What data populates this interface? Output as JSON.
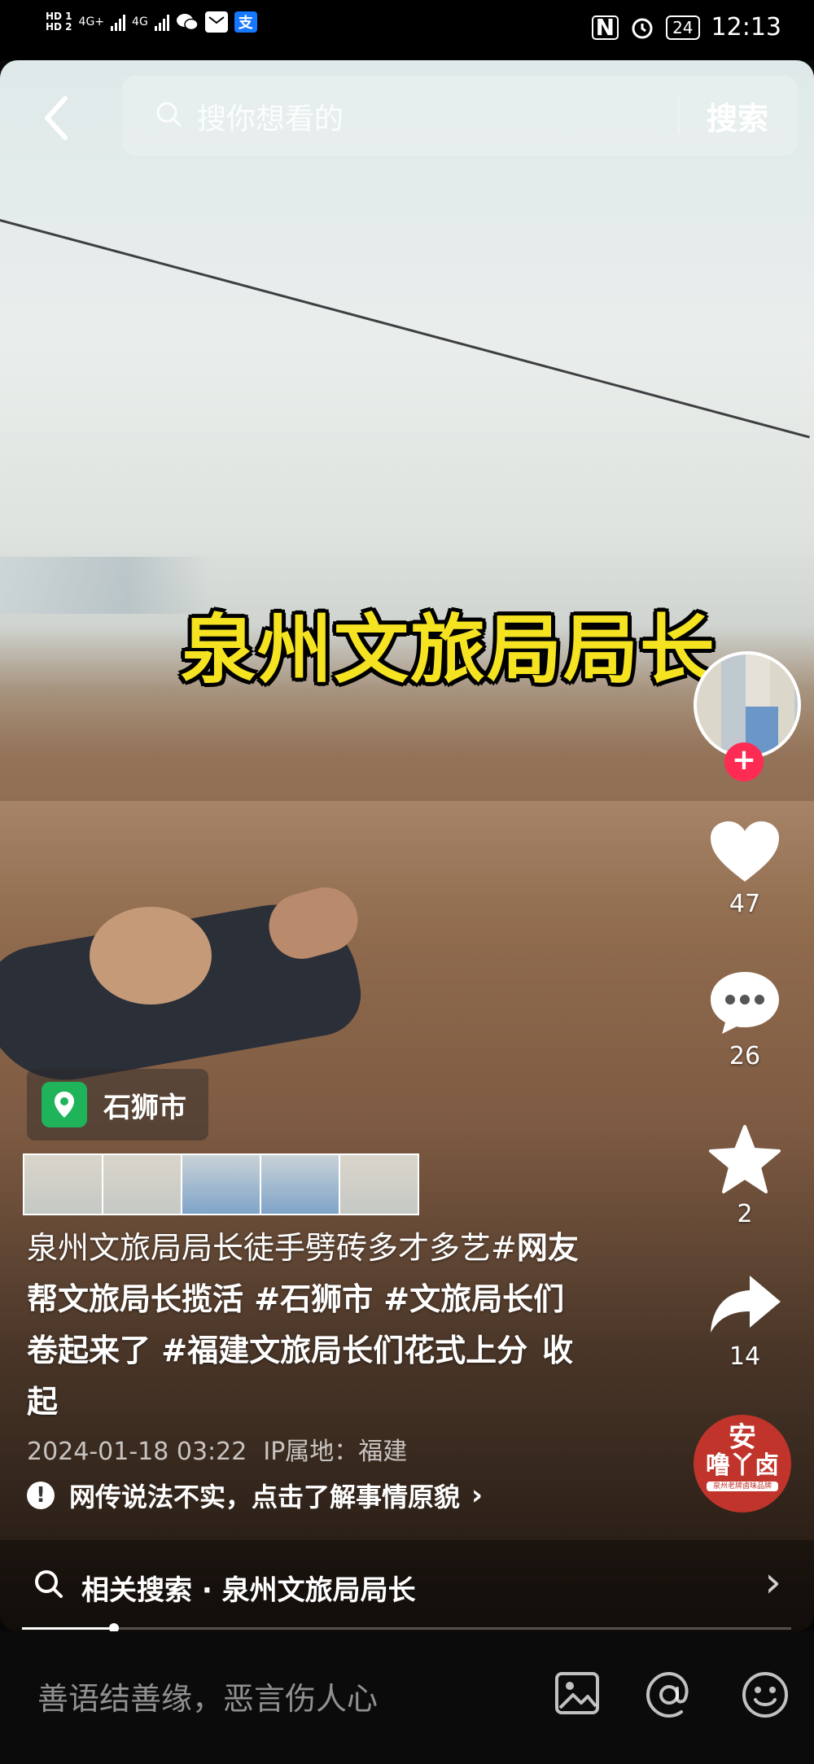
{
  "status_bar": {
    "hd1": "HD 1",
    "hd2": "HD 2",
    "network1": "4G+",
    "network2": "4G",
    "battery": "24",
    "time": "12:13",
    "icons": [
      "wechat-icon",
      "message-icon",
      "alipay-icon",
      "nfc-icon",
      "alarm-icon"
    ]
  },
  "search": {
    "placeholder": "搜你想看的",
    "button": "搜索"
  },
  "video": {
    "overlay_caption": "泉州文旅局局长"
  },
  "actions": {
    "likes": "47",
    "comments": "26",
    "favorites": "2",
    "shares": "14",
    "follow": "+"
  },
  "brand_badge": {
    "mark": "安",
    "name": "噜丫卤",
    "tagline": "泉州老牌卤味品牌"
  },
  "location": {
    "name": "石狮市"
  },
  "description": {
    "line1": "泉州文旅局局长徒手劈砖多才多艺#",
    "tags": "网友帮文旅局长揽活 #石狮市 #文旅局长们卷起来了 #福建文旅局长们花式上分",
    "collapse": "收起"
  },
  "meta": {
    "date": "2024-01-18 03:22",
    "ip": "IP属地：福建"
  },
  "notice": {
    "text": "网传说法不实，点击了解事情原貌",
    "chevron": "›"
  },
  "related_search": {
    "label": "相关搜索 · 泉州文旅局局长",
    "chevron": "›"
  },
  "progress": {
    "fraction": 0.12
  },
  "comment_bar": {
    "placeholder": "善语结善缘，恶言伤人心"
  }
}
